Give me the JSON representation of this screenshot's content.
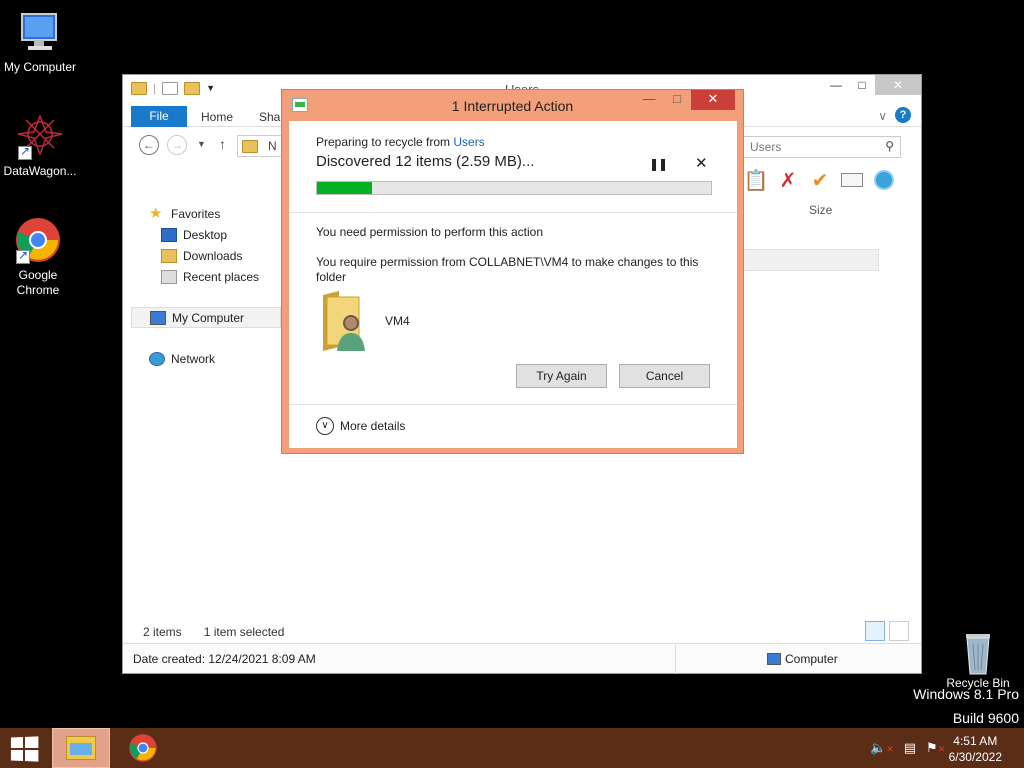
{
  "desktop": {
    "icons": [
      {
        "label": "My Computer"
      },
      {
        "label": "DataWagon..."
      },
      {
        "label": "Google\nChrome"
      }
    ],
    "recycle_bin": "Recycle Bin",
    "watermark": {
      "line1": "Windows 8.1 Pro",
      "line2": "Build 9600"
    }
  },
  "explorer": {
    "title": "Users",
    "tabs": {
      "file": "File",
      "home": "Home",
      "share": "Shar"
    },
    "address_abbrev": "N",
    "search_placeholder": "Users",
    "column_size": "Size",
    "nav": {
      "favorites": "Favorites",
      "desktop": "Desktop",
      "downloads": "Downloads",
      "recent": "Recent places",
      "my_computer": "My Computer",
      "network": "Network"
    },
    "status": {
      "items": "2 items",
      "selected": "1 item selected"
    },
    "details": {
      "date_created": "Date created: 12/24/2021 8:09 AM",
      "location": "Computer"
    }
  },
  "dialog": {
    "title": "1 Interrupted Action",
    "preparing_prefix": "Preparing to recycle from ",
    "preparing_link": "Users",
    "discovered": "Discovered 12 items (2.59 MB)...",
    "progress": 0.14,
    "need_permission": "You need permission to perform this action",
    "require_permission": "You require permission from COLLABNET\\VM4 to make changes to this folder",
    "owner": "VM4",
    "try_again": "Try Again",
    "cancel": "Cancel",
    "more_details": "More details"
  },
  "taskbar": {
    "time": "4:51 AM",
    "date": "6/30/2022"
  }
}
